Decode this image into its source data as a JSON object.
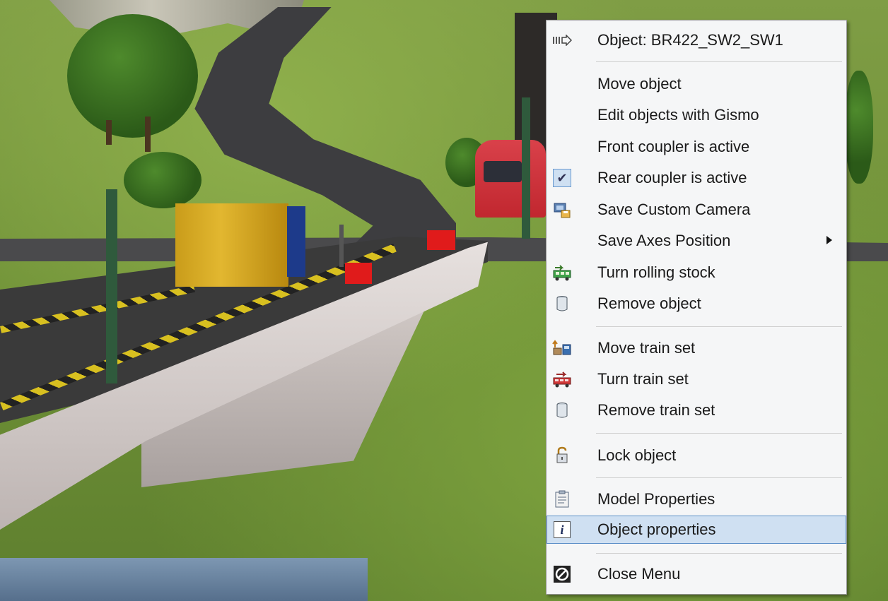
{
  "menu": {
    "header": "Object: BR422_SW2_SW1",
    "items": [
      {
        "label": "Move object",
        "icon": "none"
      },
      {
        "label": "Edit objects with Gismo",
        "icon": "none"
      },
      {
        "label": "Front coupler is active",
        "icon": "none"
      },
      {
        "label": "Rear coupler is active",
        "icon": "checkbox-checked-icon"
      },
      {
        "label": "Save Custom Camera",
        "icon": "camera-save-icon"
      },
      {
        "label": "Save Axes Position",
        "icon": "none",
        "submenu": true
      },
      {
        "label": "Turn rolling stock",
        "icon": "turn-wagon-icon"
      },
      {
        "label": "Remove object",
        "icon": "trash-can-icon"
      },
      {
        "label": "Move train set",
        "icon": "move-train-icon"
      },
      {
        "label": "Turn train set",
        "icon": "turn-train-icon"
      },
      {
        "label": "Remove train set",
        "icon": "trash-can-icon"
      },
      {
        "label": "Lock object",
        "icon": "padlock-icon"
      },
      {
        "label": "Model Properties",
        "icon": "clipboard-icon"
      },
      {
        "label": "Object properties",
        "icon": "info-icon",
        "highlighted": true
      },
      {
        "label": "Close Menu",
        "icon": "close-circle-icon"
      }
    ],
    "check_mark": "✔",
    "info_glyph": "i"
  },
  "colors": {
    "menu_bg": "#f5f6f7",
    "highlight_bg": "#cfe0f2",
    "highlight_border": "#5b8fc8"
  }
}
